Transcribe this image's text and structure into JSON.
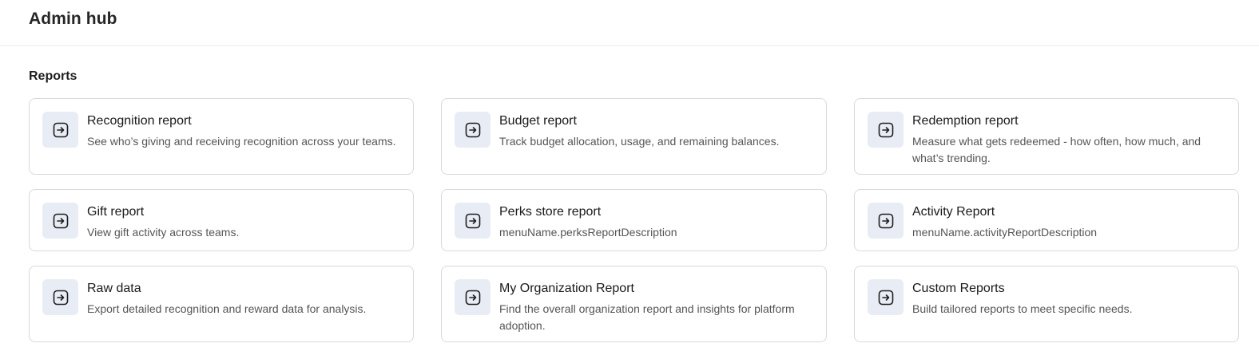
{
  "header": {
    "title": "Admin hub"
  },
  "reports": {
    "section_title": "Reports",
    "cards": [
      {
        "title": "Recognition report",
        "description": "See who’s giving and receiving recognition across your teams.",
        "icon": "arrow-right-box-icon"
      },
      {
        "title": "Budget report",
        "description": "Track budget allocation, usage, and remaining balances.",
        "icon": "arrow-right-box-icon"
      },
      {
        "title": "Redemption report",
        "description": "Measure what gets redeemed - how often, how much, and what’s trending.",
        "icon": "arrow-right-box-icon"
      },
      {
        "title": "Gift report",
        "description": "View gift activity across teams.",
        "icon": "arrow-right-box-icon"
      },
      {
        "title": "Perks store report",
        "description": "menuName.perksReportDescription",
        "icon": "arrow-right-box-icon"
      },
      {
        "title": "Activity Report",
        "description": "menuName.activityReportDescription",
        "icon": "arrow-right-box-icon"
      },
      {
        "title": "Raw data",
        "description": "Export detailed recognition and reward data for analysis.",
        "icon": "arrow-right-box-icon"
      },
      {
        "title": "My Organization Report",
        "description": "Find the overall organization report and insights for platform adoption.",
        "icon": "arrow-right-box-icon"
      },
      {
        "title": "Custom Reports",
        "description": "Build tailored reports to meet specific needs.",
        "icon": "arrow-right-box-icon"
      }
    ]
  },
  "colors": {
    "icon_background": "#e8ecf5",
    "card_border": "#d9d9d9",
    "description_text": "#555555"
  }
}
